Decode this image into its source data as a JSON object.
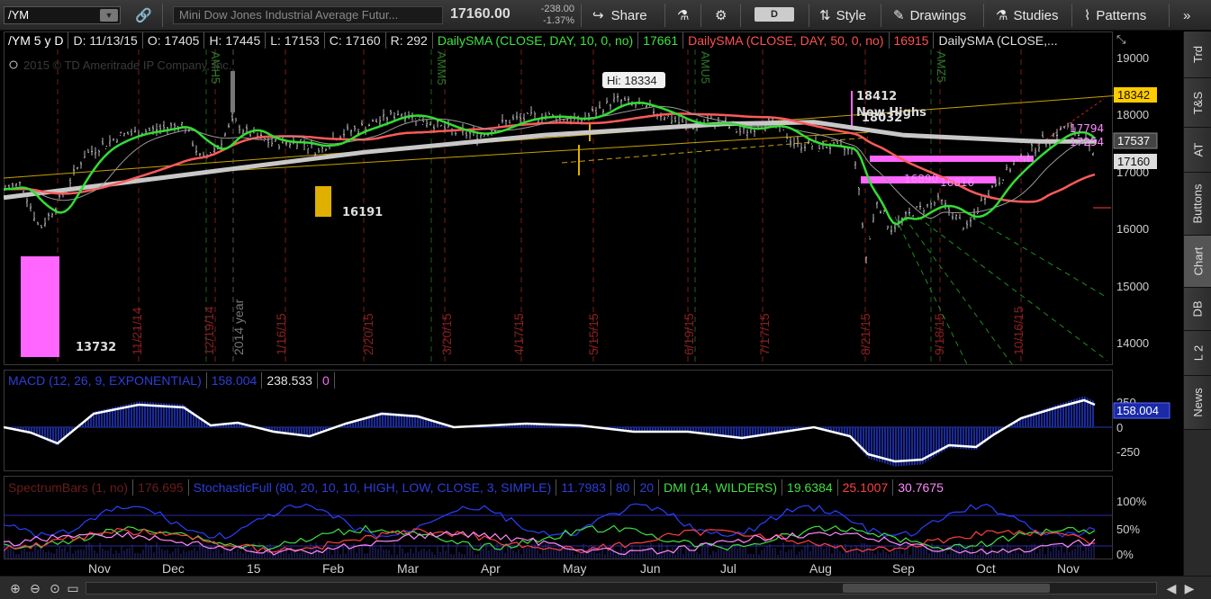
{
  "toolbar": {
    "symbol": "/YM",
    "description": "Mini Dow Jones Industrial Average Futur...",
    "last_price": "17160.00",
    "net_change": "-238.00",
    "pct_change": "-1.37%",
    "share_label": "Share",
    "aggregation": "D",
    "style_label": "Style",
    "drawings_label": "Drawings",
    "studies_label": "Studies",
    "patterns_label": "Patterns"
  },
  "header": {
    "symbol_period": "/YM 5 y D",
    "date": "D: 11/13/15",
    "open": "O: 17405",
    "high": "H: 17445",
    "low": "L: 17153",
    "close": "C: 17160",
    "range": "R: 292",
    "sma10_label": "DailySMA (CLOSE, DAY, 10, 0, no)",
    "sma10_value": "17661",
    "sma50_label": "DailySMA (CLOSE, DAY, 50, 0, no)",
    "sma50_value": "16915",
    "sma_other_label": "DailySMA (CLOSE,..."
  },
  "chart": {
    "watermark": "2015 © TD Ameritrade IP Company, Inc.",
    "price_axis": [
      "19000",
      "18000",
      "17000",
      "16000",
      "15000",
      "14000"
    ],
    "price_flags": [
      "18342",
      "17537",
      "17160"
    ],
    "hi_label": "Hi: 18334",
    "annotations": {
      "new_highs": "New Highs",
      "val_18412": "18412",
      "val_18032": "18032",
      "val_16191": "16191",
      "val_13732": "13732",
      "val_16890": "16890",
      "val_16816": "16816",
      "val_17794": "17794",
      "val_17254": "17254"
    },
    "date_markers": [
      "10/17/14",
      "11/21/14",
      "12/19/14",
      "1/16/15",
      "2/20/15",
      "3/20/15",
      "4/17/15",
      "5/15/15",
      "6/19/15",
      "7/17/15",
      "8/21/15",
      "9/18/15",
      "10/16/15"
    ],
    "year_marker": "2014 year",
    "expiry_markers": [
      "AMH5",
      "AMM5",
      "AMU5",
      "AMZ5"
    ],
    "x_axis": [
      "Nov",
      "Dec",
      "15",
      "Feb",
      "Mar",
      "Apr",
      "May",
      "Jun",
      "Jul",
      "Aug",
      "Sep",
      "Oct",
      "Nov"
    ]
  },
  "macd": {
    "label": "MACD (12, 26, 9, EXPONENTIAL)",
    "value": "158.004",
    "avg": "238.533",
    "diff": "0",
    "axis": [
      "250",
      "0",
      "-250"
    ],
    "flag": "158.004"
  },
  "lower": {
    "spectrum_label": "SpectrumBars (1, no)",
    "spectrum_value": "176.695",
    "stoch_label": "StochasticFull (80, 20, 10, 10, HIGH, LOW, CLOSE, 3, SIMPLE)",
    "stoch_k": "11.7983",
    "stoch_ob": "80",
    "stoch_os": "20",
    "dmi_label": "DMI (14, WILDERS)",
    "dmi_plus": "19.6384",
    "dmi_minus": "25.1007",
    "adx": "30.7675",
    "axis": [
      "100%",
      "50%",
      "0%"
    ]
  },
  "side_tabs": [
    "Trd",
    "T&S",
    "AT",
    "Buttons",
    "Chart",
    "DB",
    "L 2",
    "News"
  ],
  "colors": {
    "sma10": "#33dd33",
    "sma50": "#ff5a5a",
    "sma200": "#cccccc",
    "macd": "#ffffff",
    "hist": "#1a2a9a",
    "pink": "#ff66ff",
    "gold": "#e0b000"
  }
}
